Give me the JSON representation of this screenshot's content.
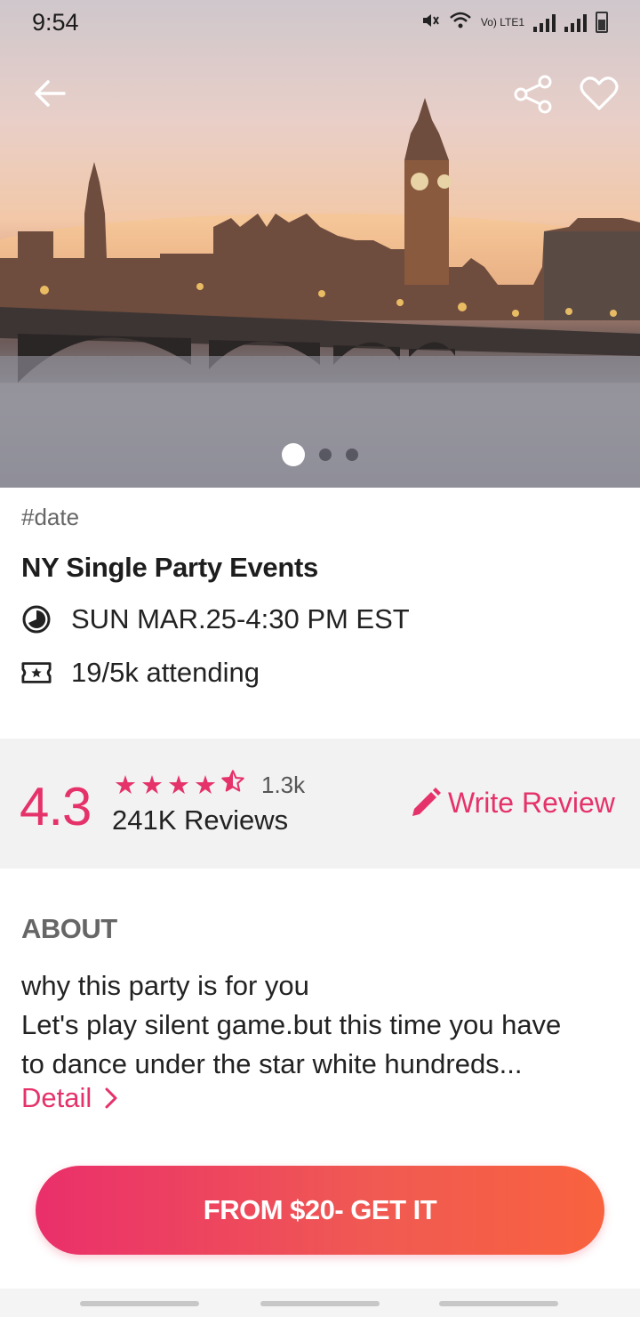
{
  "status_bar": {
    "time": "9:54",
    "network": "Vo) LTE1"
  },
  "header": {
    "back_icon": "arrow-left-icon",
    "share_icon": "share-icon",
    "favorite_icon": "heart-outline-icon",
    "carousel": {
      "count": 3,
      "active_index": 0
    }
  },
  "event": {
    "tag": "#date",
    "title": "NY Single Party Events",
    "datetime": "SUN MAR.25-4:30 PM EST",
    "attending": "19/5k attending"
  },
  "rating": {
    "score": "4.3",
    "stars": 4.5,
    "rating_count": "1.3k",
    "reviews_label": "241K Reviews",
    "write_review_label": "Write Review"
  },
  "about": {
    "heading": "ABOUT",
    "lines": [
      "why this party is for you",
      "Let's play silent game.but this time you have",
      "to dance under the star white hundreds..."
    ],
    "detail_label": "Detail"
  },
  "cta": {
    "label": "FROM $20- GET IT"
  },
  "colors": {
    "accent": "#e5326a",
    "cta_start": "#ea2f6b",
    "cta_end": "#f9623e",
    "band": "#f2f2f2"
  }
}
